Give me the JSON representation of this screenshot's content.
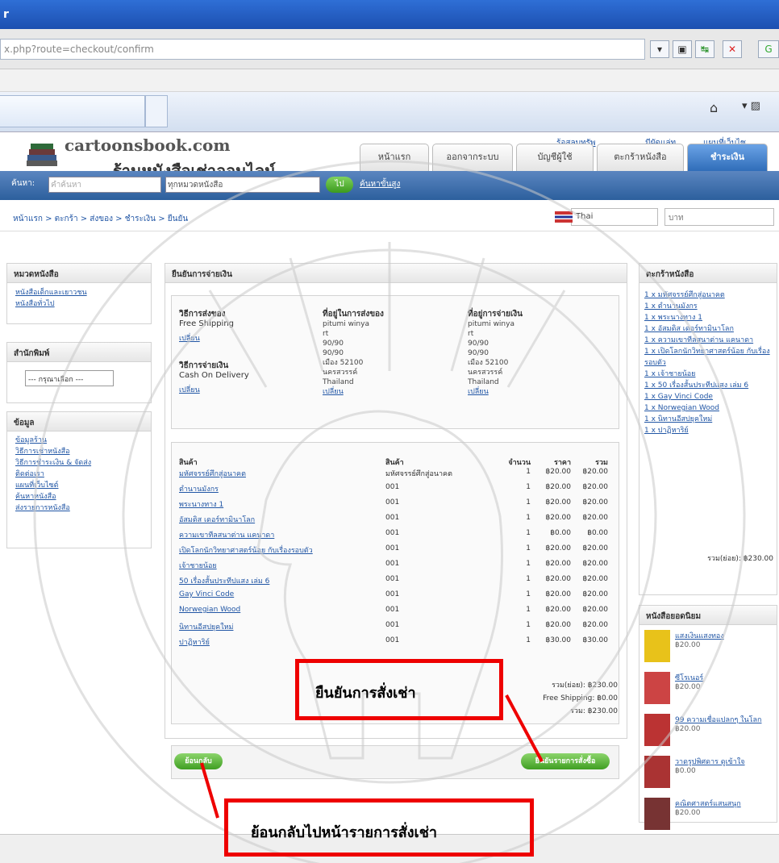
{
  "browser": {
    "title": "r",
    "url": "x.php?route=checkout/confirm"
  },
  "site": {
    "name": "cartoonsbook.com",
    "subtitle": "ร้านหนังสือเช่าออนไลน์"
  },
  "toplinks": [
    "ร้อสลบทรัพ",
    "มีผัดแล่ท",
    "แผนที่เว็บไซ"
  ],
  "nav": [
    "หน้าแรก",
    "ออกจากระบบ",
    "บัญชีผู้ใช้",
    "ตะกร้าหนังสือ",
    "ชำระเงิน"
  ],
  "search": {
    "label": "ค้นหา:",
    "placeholder": "คำค้นหา",
    "category": "ทุกหมวดหนังสือ",
    "go": "ไป",
    "advanced": "ค้นหาขั้นสูง"
  },
  "breadcrumb": "หน้าแรก > ตะกร้า > ส่งของ > ชำระเงิน > ยืนยัน",
  "language": "Thai",
  "currency": "บาท",
  "left": {
    "categories_title": "หมวดหนังสือ",
    "categories": [
      "หนังสือเด็กและเยาวชน",
      "หนังสือทั่วไป"
    ],
    "publisher_title": "สำนักพิมพ์",
    "publisher_select": "--- กรุณาเลือก ---",
    "info_title": "ข้อมูล",
    "info_links": [
      "ข้อมูลร้าน",
      "วิธีการเช่าหนังสือ",
      "วิธีการชำระเงิน & จัดส่ง",
      "ติดต่อเรา",
      "แผนที่เว็บไซต์",
      "ค้นหาหนังสือ",
      "ส่งรายการหนังสือ"
    ]
  },
  "main": {
    "title": "ยืนยันการจ่ายเงิน",
    "shipping_method_label": "วิธีการส่งของ",
    "shipping_method": "Free Shipping",
    "change": "เปลี่ยน",
    "payment_method_label": "วิธีการจ่ายเงิน",
    "payment_method": "Cash On Delivery",
    "ship_addr_label": "ที่อยู่ในการส่งของ",
    "pay_addr_label": "ที่อยู่การจ่ายเงิน",
    "address": [
      "pitumi winya",
      "rt",
      "90/90",
      "90/90",
      "เมือง 52100",
      "นครสวรรค์",
      "Thailand"
    ],
    "table_headers": [
      "สินค้า",
      "สินค้า",
      "จำนวน",
      "ราคา",
      "รวม"
    ],
    "items": [
      [
        "มหัศจรรย์ศึกสู่อนาคต",
        "มหัศจรรย์ศึกสู่อนาคต",
        "1",
        "฿20.00",
        "฿20.00"
      ],
      [
        "ตำนานมังกร",
        "001",
        "1",
        "฿20.00",
        "฿20.00"
      ],
      [
        "พระนางทาง 1",
        "001",
        "1",
        "฿20.00",
        "฿20.00"
      ],
      [
        "อัสมดิส เดอร์ทามินาโลก",
        "001",
        "1",
        "฿20.00",
        "฿20.00"
      ],
      [
        "ความเขาทีลสนาต่าน แคนาดา",
        "001",
        "1",
        "฿0.00",
        "฿0.00"
      ],
      [
        "เปิดโลกนักวิทยาศาสตร์น้อย กับเรื่องรอบตัว",
        "001",
        "1",
        "฿20.00",
        "฿20.00"
      ],
      [
        "เจ้าชายน้อย",
        "001",
        "1",
        "฿20.00",
        "฿20.00"
      ],
      [
        "50 เรื่องสั้นประทีปแสง เล่ม 6",
        "001",
        "1",
        "฿20.00",
        "฿20.00"
      ],
      [
        "Gay Vinci Code",
        "001",
        "1",
        "฿20.00",
        "฿20.00"
      ],
      [
        "Norwegian Wood",
        "001",
        "1",
        "฿20.00",
        "฿20.00"
      ],
      [
        "นิทานอีสปยุคใหม่",
        "001",
        "1",
        "฿20.00",
        "฿20.00"
      ],
      [
        "ปาฏิหาริย์",
        "001",
        "1",
        "฿30.00",
        "฿30.00"
      ]
    ],
    "subtotal": "รวม(ย่อย): ฿230.00",
    "shipping": "Free Shipping: ฿0.00",
    "total": "รวม: ฿230.00",
    "back_button": "ย้อนกลับ",
    "confirm_button": "ยืนยันรายการสั่งซื้อ"
  },
  "right": {
    "cart_title": "ตะกร้าหนังสือ",
    "cart_items": [
      "1 x มหัศจรรย์ศึกสู่อนาคต",
      "1 x ตำนานมังกร",
      "1 x พระนางทาง 1",
      "1 x อัสมดิส เดอร์ทามินาโลก",
      "1 x ความเขาทีลสนาต่าน แคนาดา",
      "1 x เปิดโลกนักวิทยาศาสตร์น้อย กับเรื่องรอบตัว",
      "1 x เจ้าชายน้อย",
      "1 x 50 เรื่องสั้นประทีปแสง เล่ม 6",
      "1 x Gay Vinci Code",
      "1 x Norwegian Wood",
      "1 x นิทานอีสปยุคใหม่",
      "1 x ปาฏิหาริย์"
    ],
    "cart_subtotal": "รวม(ย่อย): ฿230.00",
    "best_title": "หนังสือยอดนิยม",
    "best": [
      [
        "แสงเงินแสงทอง",
        "฿20.00"
      ],
      [
        "ซีโรเนอร์",
        "฿20.00"
      ],
      [
        "99 ความเชื่อแปลกๆ ในโลก",
        "฿20.00"
      ],
      [
        "วาดรูปพิศดาร ดูเข้าใจ",
        "฿0.00"
      ],
      [
        "คณิตศาสตร์แสนสนุก",
        "฿20.00"
      ]
    ]
  },
  "callouts": {
    "confirm": "ยืนยันการสั่งเช่า",
    "back": "ย้อนกลับไปหน้ารายการสั่งเช่า"
  },
  "colors": {
    "link": "#2156a5",
    "callout": "#ee0000",
    "nav_active": "#2f6db9"
  }
}
